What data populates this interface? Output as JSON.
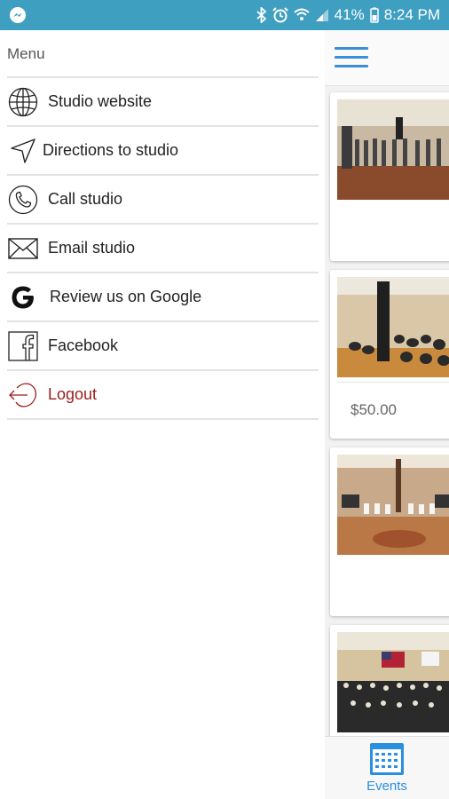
{
  "status_bar": {
    "battery": "41%",
    "time": "8:24 PM"
  },
  "drawer": {
    "title": "Menu",
    "items": [
      {
        "label": "Studio website",
        "icon": "globe-icon"
      },
      {
        "label": "Directions to studio",
        "icon": "navigation-arrow-icon"
      },
      {
        "label": "Call studio",
        "icon": "phone-icon"
      },
      {
        "label": "Email studio",
        "icon": "envelope-icon"
      },
      {
        "label": "Review us on Google",
        "icon": "google-icon"
      },
      {
        "label": "Facebook",
        "icon": "facebook-icon"
      },
      {
        "label": "Logout",
        "icon": "logout-icon"
      }
    ]
  },
  "events": {
    "cards": [
      {
        "price": ""
      },
      {
        "price": "$50.00"
      },
      {
        "price": ""
      },
      {
        "price": ""
      }
    ]
  },
  "bottom_nav": {
    "events_label": "Events"
  },
  "colors": {
    "status_bar": "#3f9fc0",
    "accent": "#2b8fe0",
    "logout": "#9b1c1c"
  }
}
